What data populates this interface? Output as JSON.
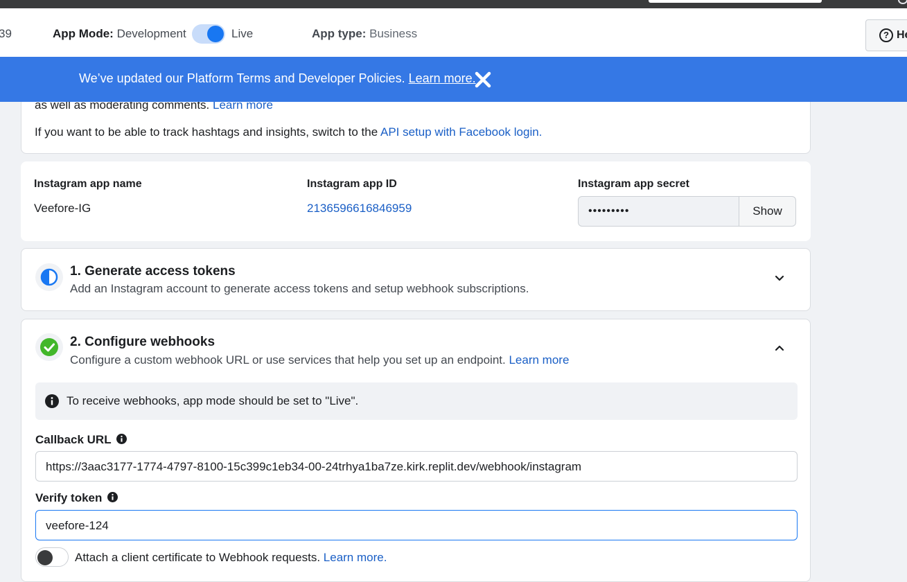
{
  "header": {
    "app_id_fragment": "39",
    "app_mode_label": "App Mode:",
    "app_mode_value": "Development",
    "live_label": "Live",
    "app_type_label": "App type:",
    "app_type_value": "Business",
    "help_label": "He",
    "live_toggle_on": true
  },
  "banner": {
    "message": "We’ve updated our Platform Terms and Developer Policies.",
    "link": "Learn more."
  },
  "intro_card": {
    "line1_text": "as well as moderating comments.",
    "line1_link": "Learn more",
    "line2_text": "If you want to be able to track hashtags and insights, switch to the",
    "line2_link": "API setup with Facebook login."
  },
  "app_details": {
    "name_label": "Instagram app name",
    "name_value": "Veefore-IG",
    "id_label": "Instagram app ID",
    "id_value": "2136596616846959",
    "secret_label": "Instagram app secret",
    "secret_value": "•••••••••",
    "show_button": "Show"
  },
  "step1": {
    "title": "1. Generate access tokens",
    "description": "Add an Instagram account to generate access tokens and setup webhook subscriptions."
  },
  "step2": {
    "title": "2. Configure webhooks",
    "description": "Configure a custom webhook URL or use services that help you set up an endpoint.",
    "description_link": "Learn more",
    "info_message": "To receive webhooks, app mode should be set to \"Live\".",
    "callback_label": "Callback URL",
    "callback_value": "https://3aac3177-1774-4797-8100-15c399c1eb34-00-24trhya1ba7ze.kirk.replit.dev/webhook/instagram",
    "verify_label": "Verify token",
    "verify_value": "veefore-124",
    "cert_label": "Attach a client certificate to Webhook requests.",
    "cert_link": "Learn more."
  },
  "colors": {
    "banner": "#3578e5",
    "link": "#1a5fc6",
    "toggle_on": "#1877f2",
    "success": "#42b72a"
  }
}
